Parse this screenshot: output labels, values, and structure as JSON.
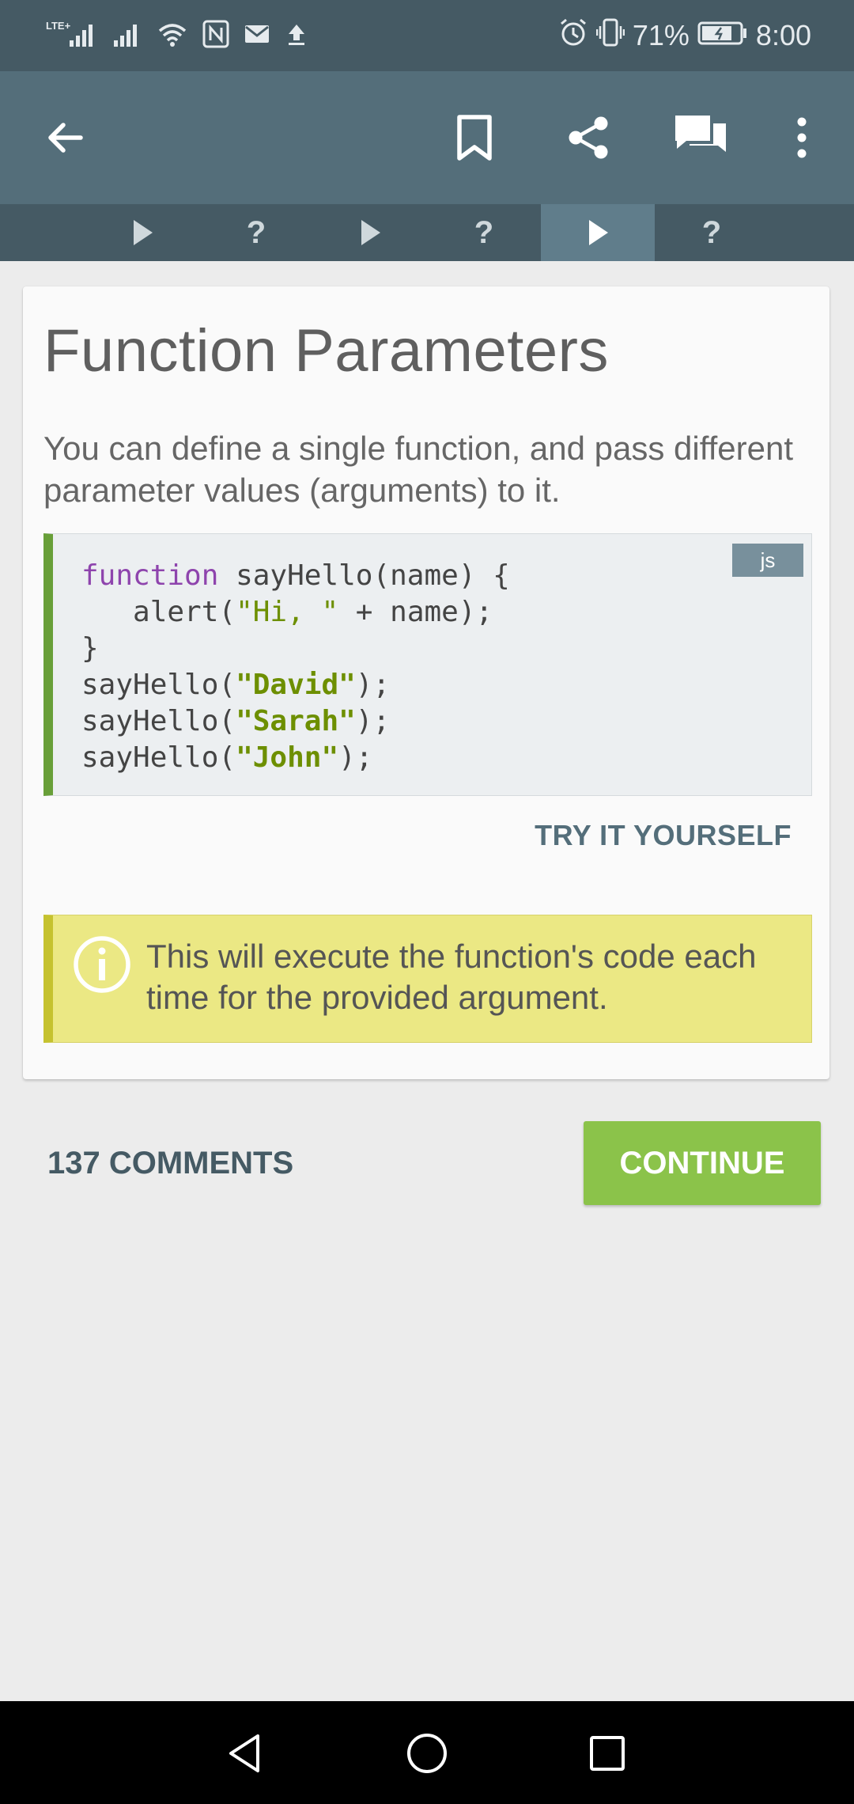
{
  "status_bar": {
    "battery": "71%",
    "time": "8:00"
  },
  "app_bar": {
    "icons": [
      "arrow-back-icon",
      "bookmark-icon",
      "share-icon",
      "comments-icon",
      "more-vert-icon"
    ]
  },
  "lesson_tabs": [
    {
      "type": "play",
      "active": false
    },
    {
      "type": "quiz",
      "label": "?",
      "active": false
    },
    {
      "type": "play",
      "active": false
    },
    {
      "type": "quiz",
      "label": "?",
      "active": false
    },
    {
      "type": "play",
      "active": true
    },
    {
      "type": "quiz",
      "label": "?",
      "active": false
    }
  ],
  "lesson": {
    "title": "Function Parameters",
    "description": "You can define a single function, and pass different parameter values (arguments) to it.",
    "code": {
      "language": "js",
      "lines": [
        "function sayHello(name) {",
        "   alert(\"Hi, \" + name);",
        "}",
        "sayHello(\"David\");",
        "sayHello(\"Sarah\");",
        "sayHello(\"John\");"
      ]
    },
    "try_label": "TRY IT YOURSELF",
    "note": "This will execute the function's code each time for the provided argument."
  },
  "footer": {
    "comments_label": "137 COMMENTS",
    "continue_label": "CONTINUE"
  },
  "colors": {
    "app_bar": "#546e7a",
    "status_bar": "#455a64",
    "accent_green": "#8bc34a",
    "code_border": "#689f38",
    "note_bg": "#ebe884"
  }
}
